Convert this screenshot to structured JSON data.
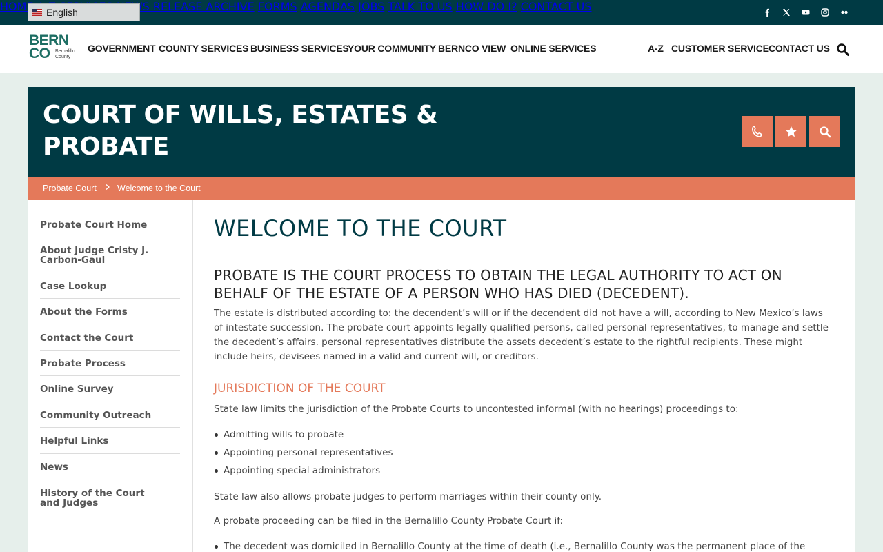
{
  "language": {
    "selected": "English"
  },
  "utility_nav": [
    "HOME",
    "A-Z SERVICES",
    "NEWS RELEASE ARCHIVE",
    "FORMS",
    "AGENDAS",
    "JOBS",
    "TALK TO US",
    "HOW DO I?",
    "CONTACT US"
  ],
  "social_icons": [
    "facebook-icon",
    "x-icon",
    "youtube-icon",
    "instagram-icon",
    "flickr-icon"
  ],
  "logo": {
    "line1": "BERN",
    "line2": "CO",
    "sub": "Bernalillo County"
  },
  "main_nav": [
    "GOVERNMENT",
    "COUNTY SERVICES",
    "BUSINESS SERVICES",
    "YOUR COMMUNITY",
    "BERNCO VIEW",
    "ONLINE SERVICES"
  ],
  "secondary_nav": [
    "A-Z",
    "CUSTOMER SERVICE",
    "CONTACT US"
  ],
  "banner": {
    "title": "COURT OF WILLS, ESTATES & PROBATE"
  },
  "breadcrumb": [
    "Probate Court",
    "Welcome to the Court"
  ],
  "sidebar": [
    "Probate Court Home",
    "About Judge Cristy J. Carbon-Gaul",
    "Case Lookup",
    "About the Forms",
    "Contact the Court",
    "Probate Process",
    "Online Survey",
    "Community Outreach",
    "Helpful Links",
    "News",
    "History of the Court and Judges"
  ],
  "main": {
    "title": "WELCOME TO THE COURT",
    "subtitle": "PROBATE IS THE COURT PROCESS TO OBTAIN THE LEGAL AUTHORITY TO ACT ON BEHALF OF THE ESTATE OF A PERSON WHO HAS DIED (DECEDENT).",
    "intro": "The estate is distributed according to: the decendent’s will or if the decendent did not have a will, according to New Mexico’s laws of intestate succession. The probate court appoints legally qualified persons, called personal representatives, to manage and settle the decedent’s affairs. personal representatives distribute the assets decedent’s estate to the rightful recipients. These might include heirs, devisees named in a valid and current will, or creditors.",
    "jurisdiction_heading": "JURISDICTION OF THE COURT",
    "jurisdiction_text": "State law limits the jurisdiction of the Probate Courts to uncontested informal (with no hearings) proceedings to:",
    "jurisdiction_list": [
      "Admitting wills to probate",
      "Appointing personal representatives",
      "Appointing special administrators"
    ],
    "marriage_text": "State law also allows probate judges to perform marriages within their county only.",
    "filing_text": "A probate proceeding can be filed in the Bernalillo County Probate Court if:",
    "filing_list": [
      "The decedent was domiciled in Bernalillo County at the time of death (i.e., Bernalillo County was the permanent place of the"
    ]
  },
  "colors": {
    "teal": "#003a44",
    "coral": "#e4795a",
    "logo_green": "#1d6e63"
  }
}
